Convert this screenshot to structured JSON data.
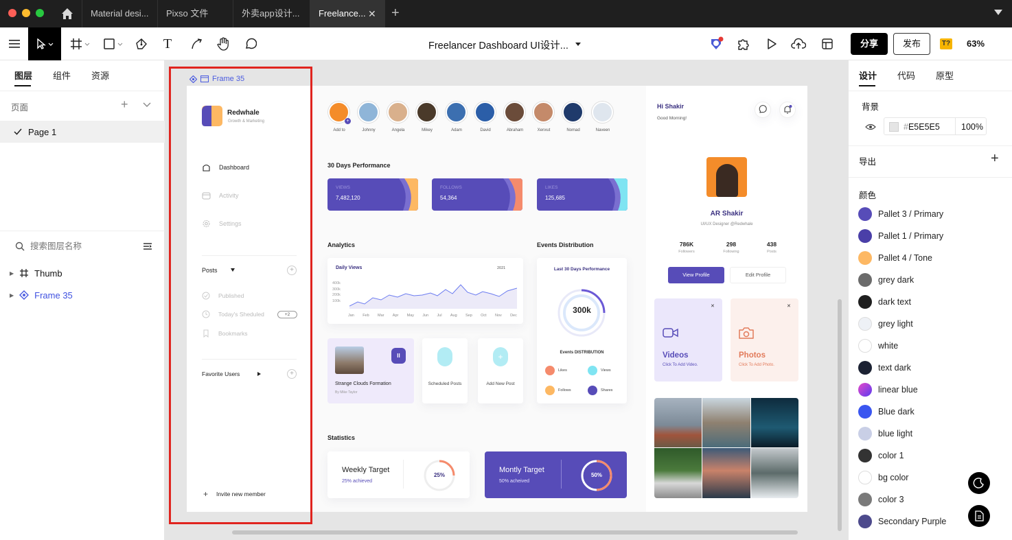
{
  "window": {
    "tabs": [
      "Material desi...",
      "Pixso 文件",
      "外卖app设计...",
      "Freelance..."
    ],
    "active_tab": "Freelance...",
    "add_tab": "+"
  },
  "toolbar": {
    "doc_title": "Freelancer Dashboard UI设计...",
    "share_label": "分享",
    "publish_label": "发布",
    "zoom": "63%",
    "badge": "T?"
  },
  "left_panel": {
    "tabs": [
      "图层",
      "组件",
      "资源"
    ],
    "pages_label": "页面",
    "pages": [
      "Page 1"
    ],
    "search_placeholder": "搜索图层名称",
    "layers": [
      "Thumb",
      "Frame 35"
    ]
  },
  "right_panel": {
    "tabs": [
      "设计",
      "代码",
      "原型"
    ],
    "background_label": "背景",
    "bg_hex": "E5E5E5",
    "bg_opacity": "100%",
    "export_label": "导出",
    "colors_label": "颜色",
    "colors": [
      {
        "name": "Pallet 3 / Primary",
        "hex": "#574cb8"
      },
      {
        "name": "Pallet 1 / Primary",
        "hex": "#4a3fa8"
      },
      {
        "name": "Pallet 4 / Tone",
        "hex": "#fdb863"
      },
      {
        "name": "grey dark",
        "hex": "#6b6b6b"
      },
      {
        "name": "dark text",
        "hex": "#1f1f1f"
      },
      {
        "name": "grey light",
        "hex": "#eef1f6"
      },
      {
        "name": "white",
        "hex": "#ffffff"
      },
      {
        "name": "text dark",
        "hex": "#1c2233"
      },
      {
        "name": "linear blue",
        "hex": "#8a4ff0"
      },
      {
        "name": "Blue dark",
        "hex": "#3a56f0"
      },
      {
        "name": "blue light",
        "hex": "#c9cfe6"
      },
      {
        "name": "color 1",
        "hex": "#333333"
      },
      {
        "name": "bg color",
        "hex": "#ffffff"
      },
      {
        "name": "color 3",
        "hex": "#7a7a7a"
      },
      {
        "name": "Secondary Purple",
        "hex": "#4d4a8c"
      }
    ]
  },
  "canvas": {
    "frame_label": "Frame 35"
  },
  "dashboard": {
    "brand": "Redwhale",
    "tagline": "Growth & Marketing",
    "nav": [
      "Dashboard",
      "Activity",
      "Settings"
    ],
    "posts_label": "Posts",
    "posts_items": [
      "Published",
      "Today's Sheduled",
      "Bookmarks"
    ],
    "scheduled_badge": "+2",
    "favorite_users": "Favorite Users",
    "invite": "Invite new member",
    "avatars": [
      "Add to",
      "Johnny",
      "Angela",
      "Mikey",
      "Adam",
      "David",
      "Abraham",
      "Xenxut",
      "Nomad",
      "Naveen"
    ],
    "performance_title": "30 Days Performance",
    "perf_cards": [
      {
        "label": "VIEWS",
        "value": "7,482,120",
        "accent": "#fdb863"
      },
      {
        "label": "FOLLOWS",
        "value": "54,364",
        "accent": "#f58b6c"
      },
      {
        "label": "LIKES",
        "value": "125,685",
        "accent": "#7fe4f2"
      }
    ],
    "analytics_title": "Analytics",
    "daily_views": "Daily Views",
    "year": "2021",
    "y_ticks": [
      "400k",
      "300k",
      "200k",
      "100k"
    ],
    "months": [
      "Jan",
      "Feb",
      "Mar",
      "Apr",
      "May",
      "Jun",
      "Jul",
      "Aug",
      "Sep",
      "Oct",
      "Nov",
      "Dec"
    ],
    "events_title": "Events Distribution",
    "events_sub": "Last 30 Days Performance",
    "events_value": "300k",
    "events_dist": "Events DISTRIBUTION",
    "events_legend": [
      "Likes",
      "Views",
      "Follows",
      "Shares"
    ],
    "post_card": {
      "title": "Strange Clouds Formation",
      "author": "By Mike Taylor"
    },
    "scheduled_posts": "Scheduled Posts",
    "add_new_post": "Add New Post",
    "statistics": "Statistics",
    "weekly": {
      "title": "Weekly Target",
      "sub": "25% achieved",
      "pct": "25%"
    },
    "monthly": {
      "title": "Montly Target",
      "sub": "50% acheived",
      "pct": "50%"
    },
    "greeting": "Hi Shakir",
    "greeting_sub": "Good Morning!",
    "profile_name": "AR Shakir",
    "profile_role": "UI/UX Designer @Redwhale",
    "stats": [
      {
        "value": "786K",
        "label": "Followers"
      },
      {
        "value": "298",
        "label": "Following"
      },
      {
        "value": "438",
        "label": "Posts"
      }
    ],
    "view_profile": "View Profile",
    "edit_profile": "Edit Profile",
    "videos": {
      "title": "Videos",
      "sub": "Click To Add Video."
    },
    "photos": {
      "title": "Photos",
      "sub": "Click To Add Photo."
    }
  }
}
